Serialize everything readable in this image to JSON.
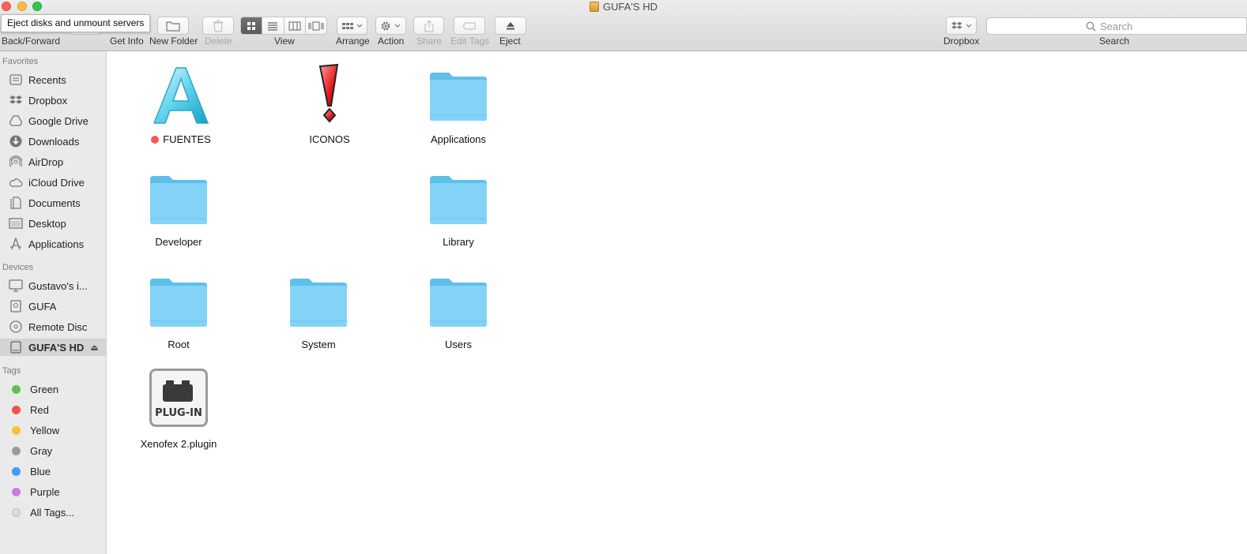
{
  "window": {
    "title": "GUFA'S HD",
    "tooltip": "Eject disks and unmount servers"
  },
  "toolbar": {
    "back_forward_label": "Back/Forward",
    "get_info_label": "Get Info",
    "new_folder_label": "New Folder",
    "delete_label": "Delete",
    "view_label": "View",
    "arrange_label": "Arrange",
    "action_label": "Action",
    "share_label": "Share",
    "edit_tags_label": "Edit Tags",
    "eject_label": "Eject",
    "dropbox_label": "Dropbox",
    "search_label": "Search",
    "search_placeholder": "Search"
  },
  "sidebar": {
    "favorites_heading": "Favorites",
    "favorites": [
      {
        "label": "Recents",
        "icon": "recents-icon"
      },
      {
        "label": "Dropbox",
        "icon": "dropbox-icon"
      },
      {
        "label": "Google Drive",
        "icon": "google-drive-icon"
      },
      {
        "label": "Downloads",
        "icon": "downloads-icon"
      },
      {
        "label": "AirDrop",
        "icon": "airdrop-icon"
      },
      {
        "label": "iCloud Drive",
        "icon": "icloud-icon"
      },
      {
        "label": "Documents",
        "icon": "documents-icon"
      },
      {
        "label": "Desktop",
        "icon": "desktop-icon"
      },
      {
        "label": "Applications",
        "icon": "applications-icon"
      }
    ],
    "devices_heading": "Devices",
    "devices": [
      {
        "label": "Gustavo's i...",
        "icon": "computer-icon"
      },
      {
        "label": "GUFA",
        "icon": "disk-icon"
      },
      {
        "label": "Remote Disc",
        "icon": "remote-disc-icon"
      },
      {
        "label": "GUFA'S HD",
        "icon": "hard-drive-icon",
        "selected": true
      }
    ],
    "tags_heading": "Tags",
    "tags": [
      {
        "label": "Green",
        "color": "#5ec24d"
      },
      {
        "label": "Red",
        "color": "#f5524b"
      },
      {
        "label": "Yellow",
        "color": "#f5c430"
      },
      {
        "label": "Gray",
        "color": "#9b9b9b"
      },
      {
        "label": "Blue",
        "color": "#3c9ef5"
      },
      {
        "label": "Purple",
        "color": "#c77de3"
      },
      {
        "label": "All Tags...",
        "color": "#dcdcdc"
      }
    ]
  },
  "items": [
    {
      "label": "FUENTES",
      "icon": "fonts-a-icon",
      "tag_color": "#fc5753"
    },
    {
      "label": "ICONOS",
      "icon": "exclamation-icon"
    },
    {
      "label": "Applications",
      "icon": "folder-icon"
    },
    {
      "label": "Developer",
      "icon": "folder-icon"
    },
    {
      "label": "Library",
      "icon": "folder-icon"
    },
    {
      "label": "Root",
      "icon": "folder-icon"
    },
    {
      "label": "System",
      "icon": "folder-icon"
    },
    {
      "label": "Users",
      "icon": "folder-icon"
    },
    {
      "label": "Xenofex 2.plugin",
      "icon": "plugin-icon",
      "badge_text": "PLUG-IN"
    }
  ],
  "colors": {
    "folder_blue": "#7fd0f5",
    "selection_gray": "#d4d4d4"
  }
}
